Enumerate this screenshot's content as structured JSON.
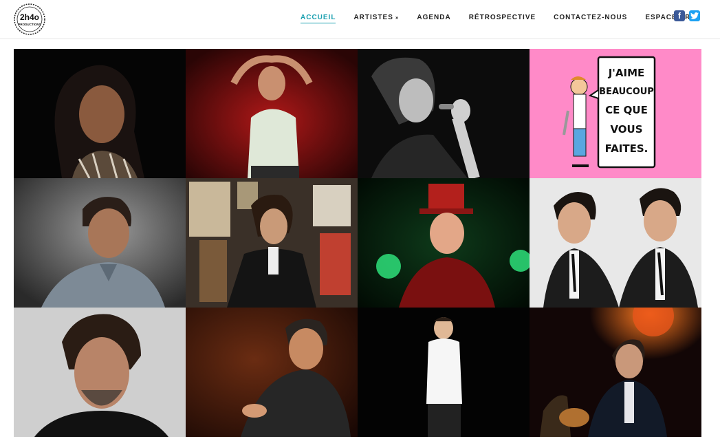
{
  "brand": {
    "logo_text": "2h4o",
    "logo_subtext": "PRODUCTIONS"
  },
  "nav": {
    "items": [
      {
        "label": "ACCUEIL",
        "active": true
      },
      {
        "label": "ARTISTES",
        "has_dropdown": true,
        "caret": "»"
      },
      {
        "label": "AGENDA"
      },
      {
        "label": "RÉTROSPECTIVE"
      },
      {
        "label": "CONTACTEZ-NOUS"
      },
      {
        "label": "ESPACE PRO"
      }
    ],
    "active_color": "#1aa0b0"
  },
  "social": {
    "facebook_icon": "facebook-icon",
    "twitter_icon": "twitter-icon"
  },
  "cartoon": {
    "lines": [
      "J'AIME",
      "BEAUCOUP",
      "CE QUE",
      "VOUS",
      "FAITES."
    ]
  }
}
